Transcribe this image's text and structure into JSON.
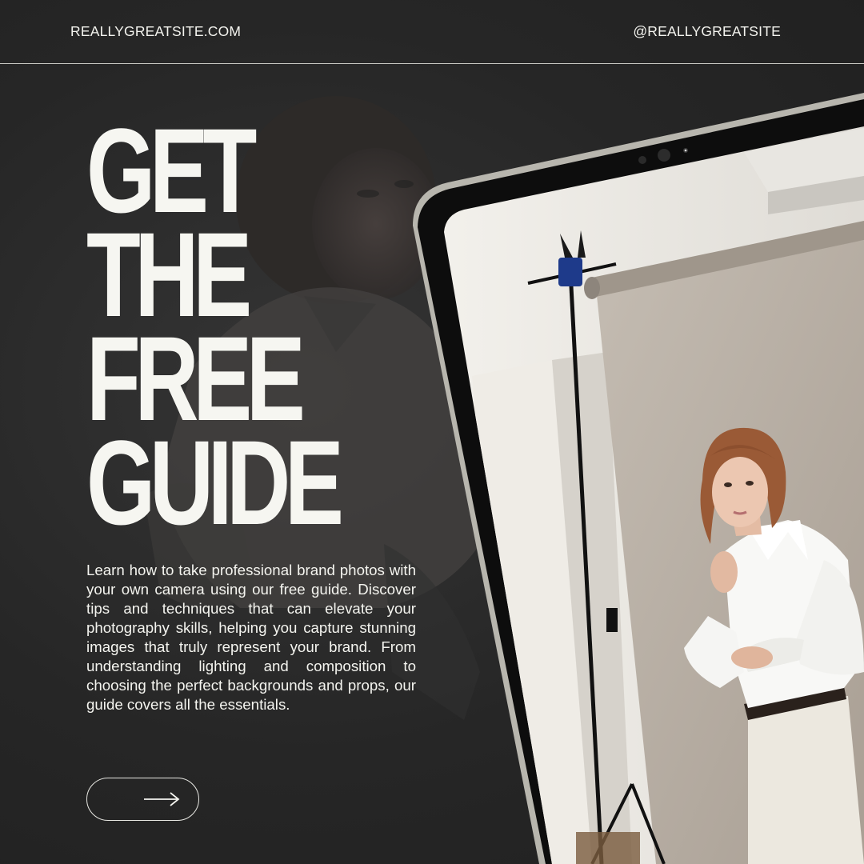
{
  "header": {
    "site_url": "REALLYGREATSITE.COM",
    "handle": "@REALLYGREATSITE"
  },
  "headline": {
    "lines": [
      "GET",
      "THE",
      "FREE",
      "GUIDE"
    ]
  },
  "description": "Learn how to take professional brand photos with your own camera using our free guide. Discover tips and techniques that can elevate your photography skills, helping you capture stunning images that truly represent your brand. From understanding lighting and composition to choosing the perfect backgrounds and props, our guide covers all the essentials.",
  "cta": {
    "icon": "arrow-right-icon"
  },
  "colors": {
    "background": "#2a2a2a",
    "text": "#f4f4ef",
    "tablet_frame": "#b8b6ae",
    "tablet_bezel": "#0d0d0d",
    "backdrop": "#b9b0a5"
  }
}
